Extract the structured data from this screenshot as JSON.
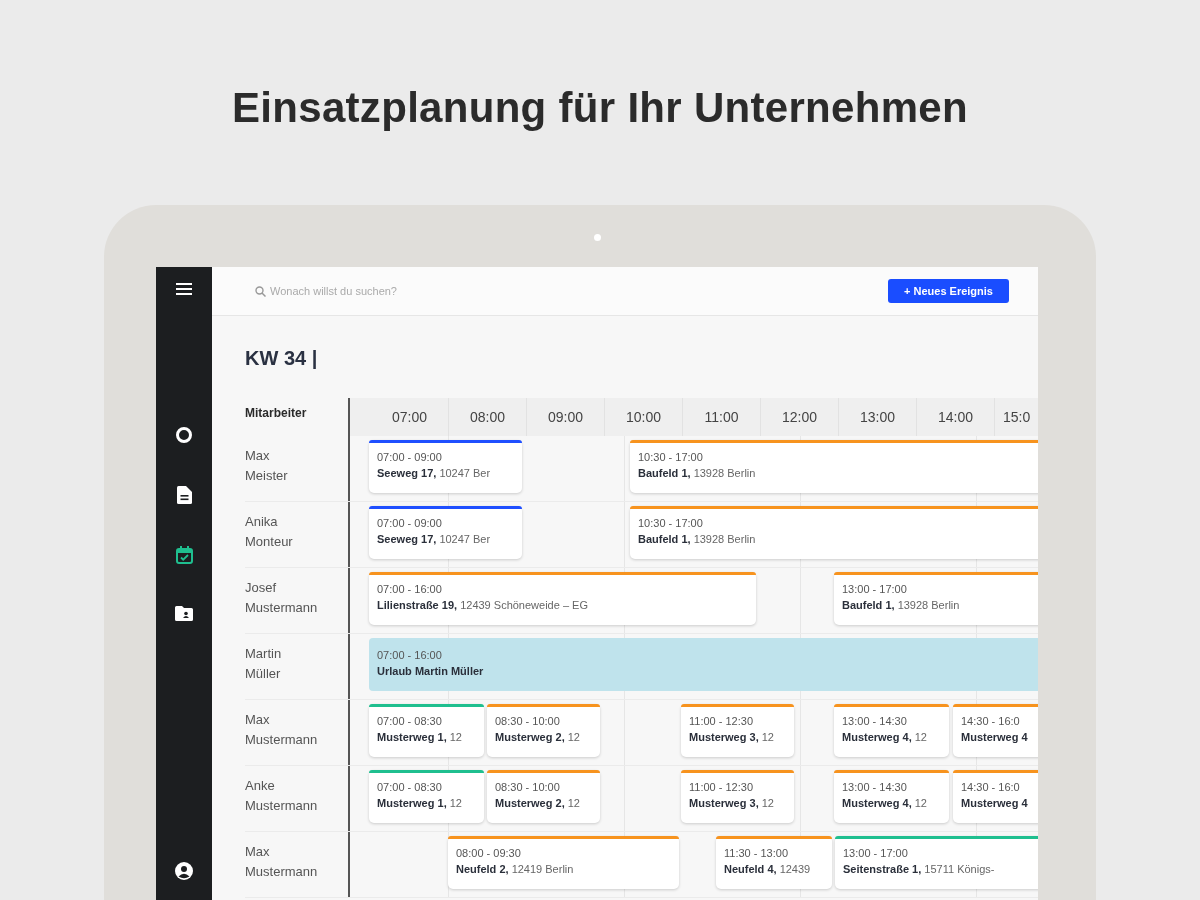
{
  "headline": "Einsatzplanung für Ihr Unternehmen",
  "sidebar": {
    "items": [
      {
        "kind": "overview",
        "selected": false
      },
      {
        "kind": "documents",
        "selected": false
      },
      {
        "kind": "calendar",
        "selected": true
      },
      {
        "kind": "folder",
        "selected": false
      }
    ]
  },
  "search": {
    "placeholder": "Wonach willst du suchen?"
  },
  "new_event_button": "+ Neues Ereignis",
  "week_title": "KW 34 |",
  "schedule": {
    "name_column": "Mitarbeiter",
    "hours": [
      "07:00",
      "08:00",
      "09:00",
      "10:00",
      "11:00",
      "12:00",
      "13:00",
      "14:00",
      "15:0"
    ],
    "rows": [
      {
        "name": "Max Meister",
        "events": [
          {
            "kind": "job",
            "color": "#1f4fff",
            "time": "07:00 - 09:00",
            "place": "**Seeweg 17,** 10247 Ber"
          },
          {
            "kind": "job",
            "color": "#f7931e",
            "time": "10:30 - 17:00",
            "place": "**Baufeld 1,** 13928 Berlin"
          }
        ]
      },
      {
        "name": "Anika Monteur",
        "events": [
          {
            "kind": "job",
            "color": "#1f4fff",
            "time": "07:00 - 09:00",
            "place": "**Seeweg 17,** 10247 Ber"
          },
          {
            "kind": "job",
            "color": "#f7931e",
            "time": "10:30 - 17:00",
            "place": "**Baufeld 1,** 13928 Berlin"
          }
        ]
      },
      {
        "name": "Josef Mustermann",
        "events": [
          {
            "kind": "job",
            "color": "#f7931e",
            "time": "07:00 - 16:00",
            "place": "**Lilienstraße 19,** 12439 Schöneweide – EG"
          },
          {
            "kind": "job",
            "color": "#f7931e",
            "time": "13:00 - 17:00",
            "place": "**Baufeld 1,** 13928 Berlin"
          }
        ]
      },
      {
        "name": "Martin Müller",
        "events": [
          {
            "kind": "absence",
            "color": "#bfe3ec",
            "time": "07:00 - 16:00",
            "place": "Urlaub Martin Müller"
          }
        ]
      },
      {
        "name": "Max Mustermann",
        "events": [
          {
            "kind": "job",
            "color": "#1fbf8f",
            "time": "07:00 - 08:30",
            "place": "**Musterweg 1,** 12"
          },
          {
            "kind": "job",
            "color": "#f7931e",
            "time": "08:30 - 10:00",
            "place": "**Musterweg 2,** 12"
          },
          {
            "kind": "job",
            "color": "#f7931e",
            "time": "11:00 - 12:30",
            "place": "**Musterweg 3,** 12"
          },
          {
            "kind": "job",
            "color": "#f7931e",
            "time": "13:00 - 14:30",
            "place": "**Musterweg 4,** 12"
          },
          {
            "kind": "job",
            "color": "#f7931e",
            "time": "14:30 - 16:0",
            "place": "**Musterweg 4**"
          }
        ]
      },
      {
        "name": "Anke Mustermann",
        "events": [
          {
            "kind": "job",
            "color": "#1fbf8f",
            "time": "07:00 - 08:30",
            "place": "**Musterweg 1,** 12"
          },
          {
            "kind": "job",
            "color": "#f7931e",
            "time": "08:30 - 10:00",
            "place": "**Musterweg 2,** 12"
          },
          {
            "kind": "job",
            "color": "#f7931e",
            "time": "11:00 - 12:30",
            "place": "**Musterweg 3,** 12"
          },
          {
            "kind": "job",
            "color": "#f7931e",
            "time": "13:00 - 14:30",
            "place": "**Musterweg 4,** 12"
          },
          {
            "kind": "job",
            "color": "#f7931e",
            "time": "14:30 - 16:0",
            "place": "**Musterweg 4**"
          }
        ]
      },
      {
        "name": "Max Mustermann",
        "events": [
          {
            "kind": "job",
            "color": "#f7931e",
            "time": "08:00 - 09:30",
            "place": "**Neufeld 2,** 12419 Berlin"
          },
          {
            "kind": "job",
            "color": "#f7931e",
            "time": "11:30 - 13:00",
            "place": "**Neufeld 4,** 12439"
          },
          {
            "kind": "job",
            "color": "#1fbf8f",
            "time": "13:00 - 17:00",
            "place": "**Seitenstraße 1,** 15711 Königs-"
          }
        ]
      }
    ]
  }
}
